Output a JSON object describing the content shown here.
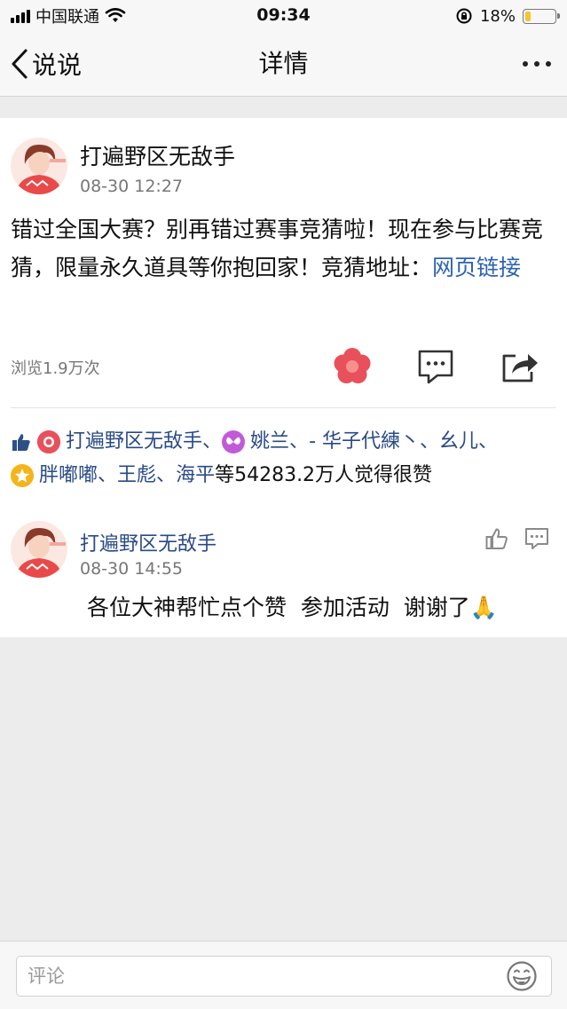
{
  "status_bar": {
    "carrier": "中国联通",
    "time": "09:34",
    "battery": "18%",
    "battery_level": 0.18
  },
  "nav": {
    "back_label": "说说",
    "title": "详情"
  },
  "post": {
    "author": "打遍野区无敌手",
    "time": "08-30 12:27",
    "text": "错过全国大赛？别再错过赛事竞猜啦！现在参与比赛竞猜，限量永久道具等你抱回家！竞猜地址：",
    "link_text": "网页链接",
    "views": "浏览1.9万次"
  },
  "likes": {
    "row1": [
      "打遍野区无敌手",
      "姚兰",
      "- 华子代練丶",
      "幺儿"
    ],
    "row2": [
      "胖嘟嘟",
      "王彪",
      "海平"
    ],
    "summary": "等54283.2万人觉得很赞"
  },
  "comment": {
    "author": "打遍野区无敌手",
    "time": "08-30 14:55",
    "text": "各位大神帮忙点个赞  参加活动  谢谢了🙏"
  },
  "input": {
    "placeholder": "评论"
  },
  "icons": {
    "back": "chevron-left-icon",
    "more": "more-icon",
    "flower": "flower-icon",
    "comment": "comment-icon",
    "share": "share-icon",
    "thumb": "thumbs-up-icon",
    "emoji": "emoji-icon"
  },
  "colors": {
    "link": "#2d63b0",
    "liker": "#2a4a86",
    "flower": "#e8505b",
    "secondary_text": "#777777"
  }
}
